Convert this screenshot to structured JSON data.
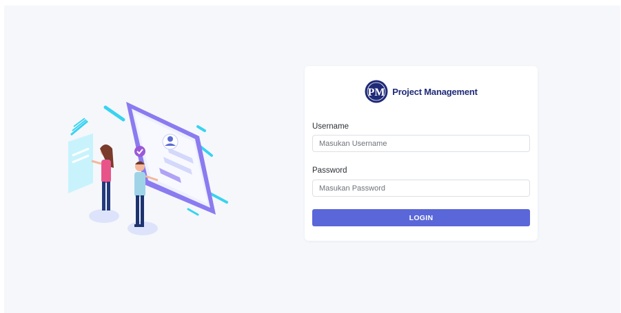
{
  "brand": {
    "logo_letters": "PM",
    "name": "Project Management"
  },
  "form": {
    "username_label": "Username",
    "username_placeholder": "Masukan Username",
    "username_value": "",
    "password_label": "Password",
    "password_placeholder": "Masukan Password",
    "password_value": "",
    "login_label": "LOGIN"
  },
  "colors": {
    "page_background": "#f5f7fb",
    "card_background": "#ffffff",
    "brand_text": "#1f2a78",
    "logo_circle": "#1f2a78",
    "button": "#5a67d8"
  },
  "illustration": {
    "icons": [
      "user-avatar-icon",
      "checkmark-icon"
    ]
  }
}
